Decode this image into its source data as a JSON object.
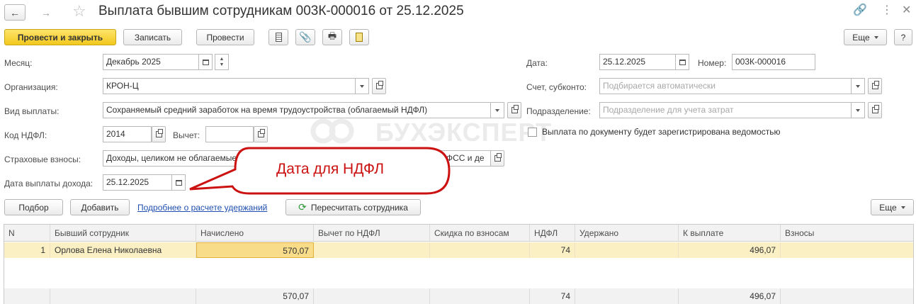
{
  "window": {
    "title": "Выплата бывшим сотрудникам 003К-000016 от 25.12.2025"
  },
  "toolbar": {
    "post_and_close": "Провести и закрыть",
    "save": "Записать",
    "post": "Провести",
    "more": "Еще",
    "help": "?"
  },
  "form": {
    "month_label": "Месяц:",
    "month_value": "Декабрь 2025",
    "org_label": "Организация:",
    "org_value": "КРОН-Ц",
    "payment_type_label": "Вид выплаты:",
    "payment_type_value": "Сохраняемый средний заработок на время трудоустройства (облагаемый НДФЛ)",
    "ndfl_code_label": "Код НДФЛ:",
    "ndfl_code_value": "2014",
    "deduction_label": "Вычет:",
    "deduction_value": "",
    "insurance_label": "Страховые взносы:",
    "insurance_value_left": "Доходы, целиком не облагаемые",
    "insurance_value_right": "ФСС и де",
    "income_date_label": "Дата выплаты дохода:",
    "income_date_value": "25.12.2025",
    "date_label": "Дата:",
    "date_value": "25.12.2025",
    "number_label": "Номер:",
    "number_value": "003К-000016",
    "account_label": "Счет, субконто:",
    "account_placeholder": "Подбирается автоматически",
    "division_label": "Подразделение:",
    "division_placeholder": "Подразделение для учета затрат",
    "statement_checkbox_label": "Выплата по документу будет зарегистрирована ведомостью",
    "statement_checked": false
  },
  "callout": {
    "text": "Дата для НДФЛ",
    "color": "#cc1111"
  },
  "grid_toolbar": {
    "pick": "Подбор",
    "add": "Добавить",
    "details_link": "Подробнее о расчете удержаний",
    "recalc": "Пересчитать сотрудника",
    "more": "Еще"
  },
  "watermark": "БУХЭКСПЕРТ",
  "table": {
    "columns": [
      "N",
      "Бывший сотрудник",
      "Начислено",
      "Вычет по НДФЛ",
      "Скидка по взносам",
      "НДФЛ",
      "Удержано",
      "К выплате",
      "Взносы"
    ],
    "rows": [
      {
        "n": "1",
        "employee": "Орлова Елена Николаевна",
        "accrued": "570,07",
        "ndfl_deduction": "",
        "discount": "",
        "ndfl": "74",
        "withheld": "",
        "to_pay": "496,07",
        "contributions": ""
      }
    ],
    "totals": {
      "accrued": "570,07",
      "ndfl": "74",
      "to_pay": "496,07"
    }
  }
}
